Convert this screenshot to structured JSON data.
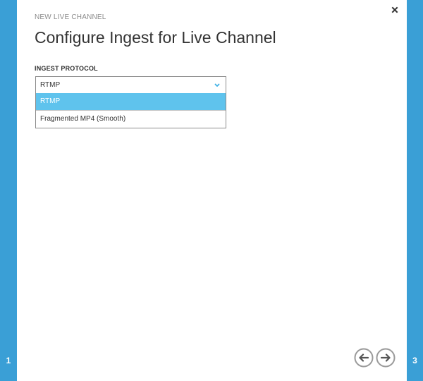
{
  "wizard": {
    "eyebrow": "NEW LIVE CHANNEL",
    "title": "Configure Ingest for Live Channel",
    "current_step": "1",
    "total_steps": "3",
    "close_icon": "close-icon",
    "back_icon": "arrow-left-circle-icon",
    "next_icon": "arrow-right-circle-icon"
  },
  "ingest_protocol": {
    "label": "INGEST PROTOCOL",
    "selected_value": "RTMP",
    "dropdown_open": true,
    "options": [
      {
        "label": "RTMP",
        "selected": true
      },
      {
        "label": "Fragmented MP4 (Smooth)",
        "selected": false
      }
    ]
  },
  "colors": {
    "rail": "#3a9fd6",
    "selected_option": "#5fc3ed",
    "chevron": "#3fb1e6",
    "nav_button": "#9a9a9a"
  }
}
